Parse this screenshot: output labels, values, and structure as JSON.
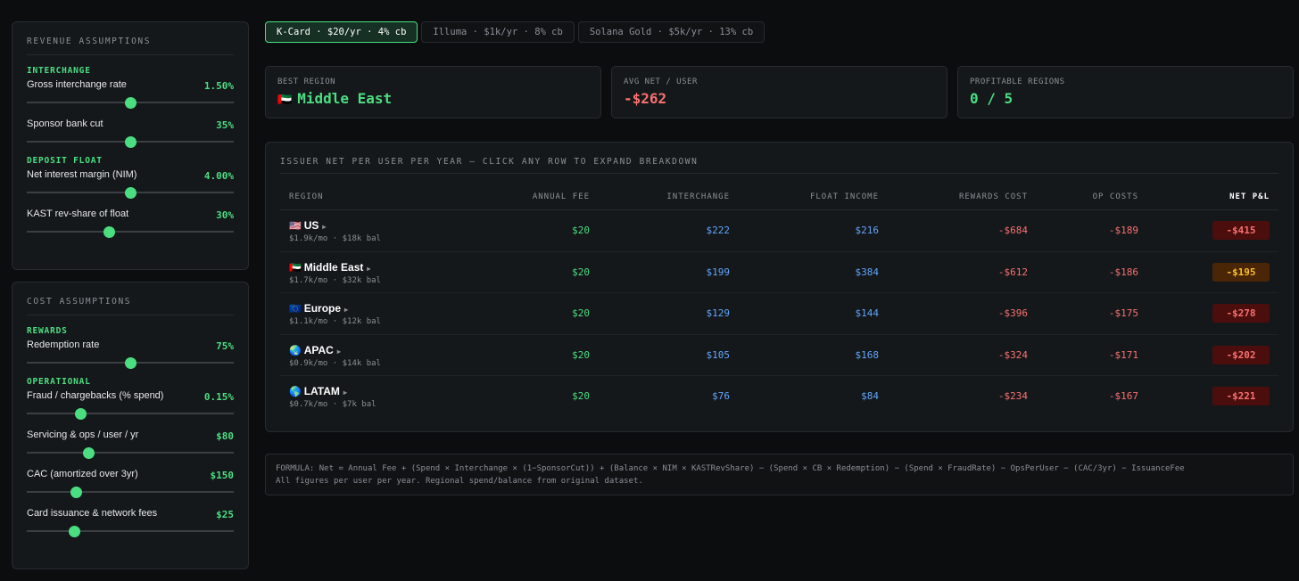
{
  "revenue": {
    "title": "REVENUE ASSUMPTIONS",
    "interchange_section": "INTERCHANGE",
    "deposit_section": "DEPOSIT FLOAT",
    "controls": [
      {
        "label": "Gross interchange rate",
        "value": "1.50%",
        "level": 0.5
      },
      {
        "label": "Sponsor bank cut",
        "value": "35%",
        "level": 0.5
      },
      {
        "label": "Net interest margin (NIM)",
        "value": "4.00%",
        "level": 0.5
      },
      {
        "label": "KAST rev-share of float",
        "value": "30%",
        "level": 0.4
      }
    ]
  },
  "costs": {
    "title": "COST ASSUMPTIONS",
    "rewards_section": "REWARDS",
    "operational_section": "OPERATIONAL",
    "controls": [
      {
        "label": "Redemption rate",
        "value": "75%",
        "level": 0.5
      },
      {
        "label": "Fraud / chargebacks (% spend)",
        "value": "0.15%",
        "level": 0.26
      },
      {
        "label": "Servicing & ops / user / yr",
        "value": "$80",
        "level": 0.3
      },
      {
        "label": "CAC (amortized over 3yr)",
        "value": "$150",
        "level": 0.24
      },
      {
        "label": "Card issuance & network fees",
        "value": "$25",
        "level": 0.23
      }
    ]
  },
  "tabs": [
    {
      "label": "K-Card · $20/yr · 4% cb",
      "active": true
    },
    {
      "label": "Illuma · $1k/yr · 8% cb",
      "active": false
    },
    {
      "label": "Solana Gold · $5k/yr · 13% cb",
      "active": false
    }
  ],
  "summary": {
    "best_region_label": "BEST REGION",
    "best_region_flag": "🇦🇪",
    "best_region_value": "Middle East",
    "avg_net_label": "AVG NET / USER",
    "avg_net_value": "-$262",
    "profitable_label": "PROFITABLE REGIONS",
    "profitable_value": "0 / 5"
  },
  "table": {
    "title": "ISSUER NET PER USER PER YEAR — CLICK ANY ROW TO EXPAND BREAKDOWN",
    "headers": {
      "region": "REGION",
      "fee": "ANNUAL FEE",
      "interchange": "INTERCHANGE",
      "float": "FLOAT INCOME",
      "rewards": "REWARDS COST",
      "op": "OP COSTS",
      "net": "NET P&L"
    },
    "rows": [
      {
        "flag": "🇺🇸",
        "name": "US",
        "sub": "$1.9k/mo · $18k bal",
        "fee": "$20",
        "interchange": "$222",
        "float": "$216",
        "rewards": "-$684",
        "op": "-$189",
        "net": "-$415",
        "tone": "loss"
      },
      {
        "flag": "🇦🇪",
        "name": "Middle East",
        "sub": "$1.7k/mo · $32k bal",
        "fee": "$20",
        "interchange": "$199",
        "float": "$384",
        "rewards": "-$612",
        "op": "-$186",
        "net": "-$195",
        "tone": "warn"
      },
      {
        "flag": "🇪🇺",
        "name": "Europe",
        "sub": "$1.1k/mo · $12k bal",
        "fee": "$20",
        "interchange": "$129",
        "float": "$144",
        "rewards": "-$396",
        "op": "-$175",
        "net": "-$278",
        "tone": "loss"
      },
      {
        "flag": "🌏",
        "name": "APAC",
        "sub": "$0.9k/mo · $14k bal",
        "fee": "$20",
        "interchange": "$105",
        "float": "$168",
        "rewards": "-$324",
        "op": "-$171",
        "net": "-$202",
        "tone": "loss"
      },
      {
        "flag": "🌎",
        "name": "LATAM",
        "sub": "$0.7k/mo · $7k bal",
        "fee": "$20",
        "interchange": "$76",
        "float": "$84",
        "rewards": "-$234",
        "op": "-$167",
        "net": "-$221",
        "tone": "loss"
      }
    ]
  },
  "formula": {
    "line1": "FORMULA: Net = Annual Fee + (Spend × Interchange × (1−SponsorCut)) + (Balance × NIM × KASTRevShare) − (Spend × CB × Redemption) − (Spend × FraudRate) − OpsPerUser − (CAC/3yr) − IssuanceFee",
    "line2": "All figures per user per year. Regional spend/balance from original dataset."
  },
  "colors": {
    "accent": "#4ade80",
    "positive_blue": "#60a5fa",
    "negative": "#f87171",
    "warning": "#fbbf24"
  }
}
